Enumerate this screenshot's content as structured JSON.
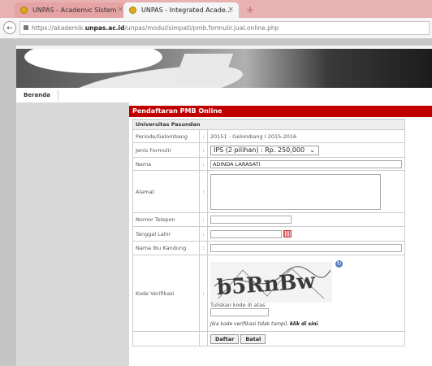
{
  "browser": {
    "tabs": [
      {
        "label": "UNPAS - Academic Sistem",
        "close": "×"
      },
      {
        "label": "UNPAS - Integrated Acade...",
        "close": "×"
      }
    ],
    "new_tab": "+",
    "back": "←",
    "url_prefix": "https://akademik.",
    "url_domain": "unpas.ac.id",
    "url_rest": "/unpas/modul/simpati/pmb.formulir.jual.online.php"
  },
  "nav": {
    "home": "Beranda"
  },
  "form": {
    "title": "Pendaftaran PMB Online",
    "university": "Universitas Pasundan",
    "colon": ":",
    "fields": {
      "periode_label": "Periode/Gelombang",
      "periode_value": "20151 - Gelombang I 2015-2016",
      "jenis_label": "Jenis Formulir",
      "jenis_value": "IPS (2 pilihan) : Rp. 250,000",
      "nama_label": "Nama",
      "nama_value": "ADINDA LARASATI",
      "alamat_label": "Alamat",
      "telepon_label": "Nomor Telepon",
      "tanggal_label": "Tanggal Lahir",
      "ibu_label": "Nama Ibu Kandung",
      "kode_label": "Kode Verifikasi",
      "captcha_text": "b5RnBw",
      "kode_hint": "Tuliskan kode di atas",
      "kode_help_prefix": "Jika kode verifikasi tidak tampil, ",
      "kode_help_link": "klik di sini"
    },
    "buttons": {
      "submit": "Daftar",
      "cancel": "Batal"
    }
  }
}
